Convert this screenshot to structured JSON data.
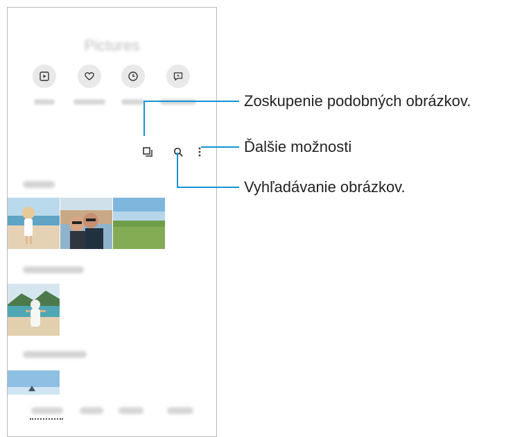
{
  "callouts": {
    "grouping": "Zoskupenie podobných obrázkov.",
    "more_options": "Ďalšie možnosti",
    "search": "Vyhľadávanie obrázkov."
  },
  "icons": {
    "categories": [
      "video-icon",
      "heart-icon",
      "clock-icon",
      "sparkle-chat-icon"
    ],
    "toolbar": [
      "group-similar-icon",
      "search-icon",
      "more-options-icon"
    ]
  },
  "colors": {
    "callout_line": "#1493d6",
    "category_bg": "#e9e9e9"
  }
}
